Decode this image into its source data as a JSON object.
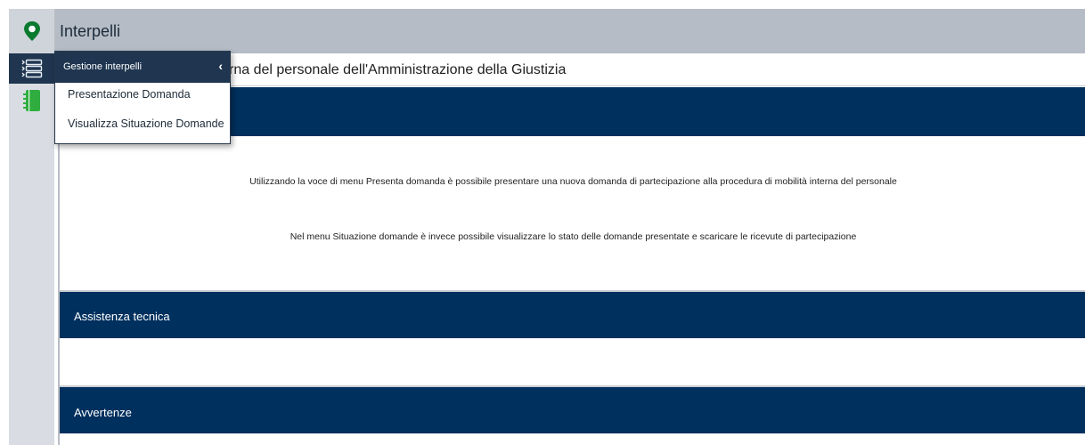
{
  "app": {
    "title": "Interpelli"
  },
  "header": {
    "subtitle": "rna del personale dell'Amministrazione della Giustizia"
  },
  "menu": {
    "header_label": "Gestione interpelli",
    "chevron": "‹",
    "items": [
      {
        "label": "Presentazione Domanda"
      },
      {
        "label": "Visualizza Situazione Domande"
      }
    ]
  },
  "main": {
    "info_lines": [
      "Utilizzando la voce di menu Presenta domanda è possibile presentare una nuova domanda di partecipazione alla procedura di mobilità interna del personale",
      "Nel menu Situazione domande è invece possibile visualizzare lo stato delle domande presentate e scaricare le ricevute di partecipazione"
    ],
    "sections": [
      {
        "title": "Assistenza tecnica"
      },
      {
        "title": "Avvertenze"
      }
    ]
  },
  "colors": {
    "band": "#00305e",
    "rail_active": "#1f3550",
    "pin_icon": "#0a7a2f",
    "book_icon": "#2fae3f"
  },
  "icons": {
    "rail_top": "map-pin-icon",
    "rail_menu": "list-menu-icon",
    "rail_book": "notebook-icon"
  }
}
